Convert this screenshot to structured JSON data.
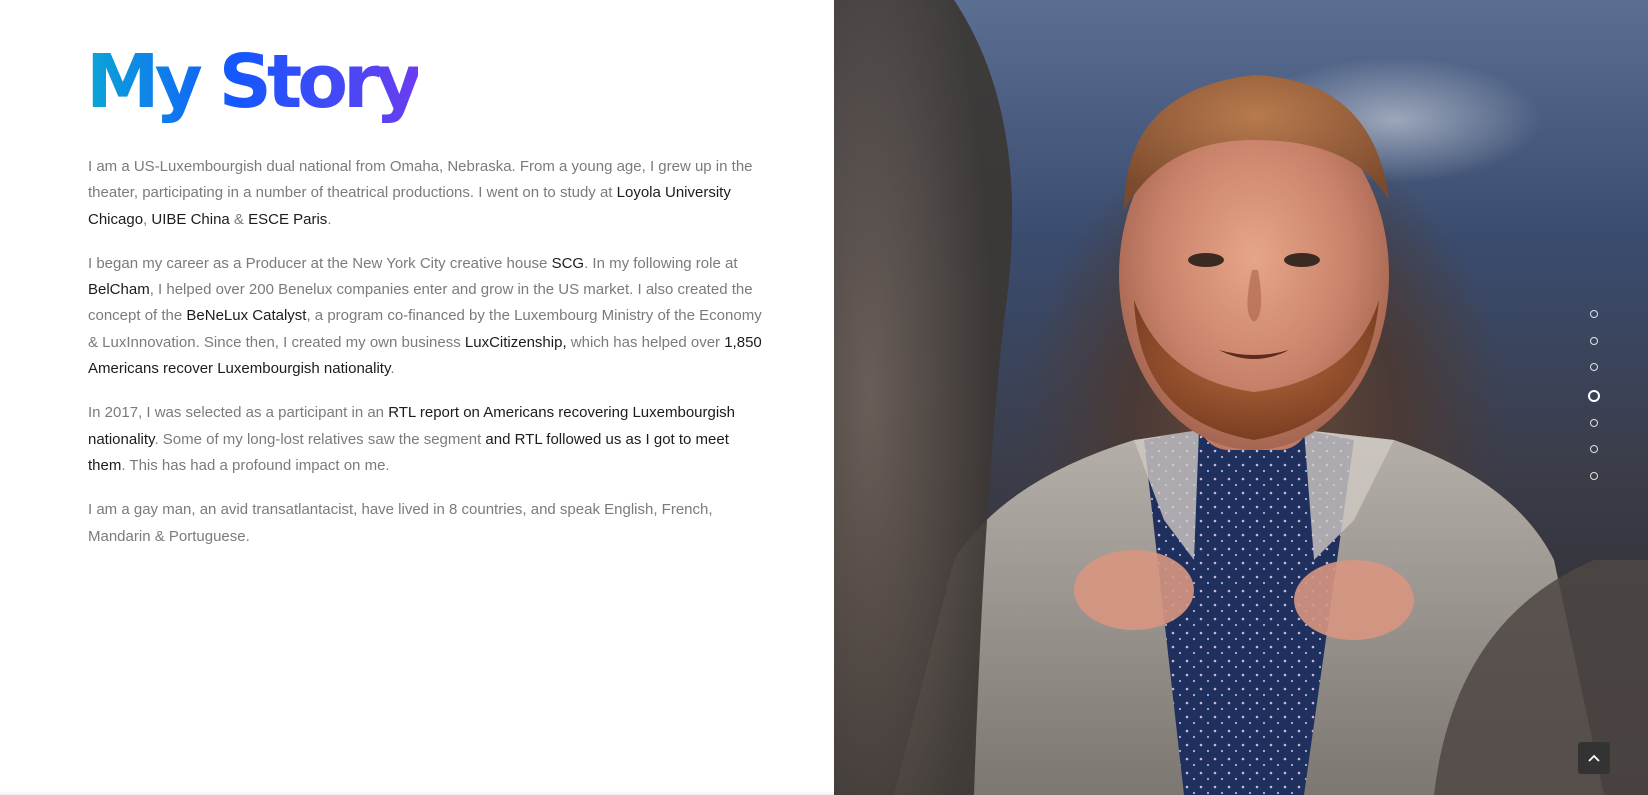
{
  "header": {
    "title": "My Story"
  },
  "story": {
    "p1": {
      "t1": "I am a US-Luxembourgish dual national from Omaha, Nebraska. From a young age, I grew up in the theater, participating in a number of theatrical productions. I went on to study at ",
      "link_loyola": "Loyola University Chicago",
      "t2": ", ",
      "link_uibe": "UIBE China",
      "t3": " & ",
      "link_esce": "ESCE Paris",
      "t4": "."
    },
    "p2": {
      "t1": "I began my career as a Producer at the New York City creative house ",
      "link_scg": "SCG",
      "t2": ". In my following role at ",
      "link_belcham": "BelCham",
      "t3": ", I helped over 200 Benelux companies enter and grow in the US market. I also created the concept of the ",
      "link_catalyst": "BeNeLux Catalyst",
      "t4": ", a program co-financed by the Luxembourg Ministry of the Economy & LuxInnovation. Since then, I created my own business ",
      "link_luxcitizenship": "LuxCitizenship,",
      "t5": " which has helped over ",
      "link_americans": "1,850 Americans recover Luxembourgish nationality",
      "t6": "."
    },
    "p3": {
      "t1": "In 2017, I was selected as a participant in an ",
      "link_rtl_report": "RTL report on Americans recovering Luxembourgish nationality",
      "t2": ". Some of my long-lost relatives saw the segment ",
      "link_rtl_followed": "and RTL followed us as I got to meet them",
      "t3": ". This has had a profound impact on me."
    },
    "p4": {
      "t1": "I am a gay man, an avid transatlantacist, have lived in 8 countries, and speak English, French, Mandarin & Portuguese."
    }
  },
  "section_nav": {
    "count": 7,
    "active_index": 3
  },
  "back_to_top": {
    "icon": "chevron-up-icon"
  },
  "colors": {
    "title_gradient": [
      "#0aa6d6",
      "#1457ff",
      "#6a3df0"
    ],
    "body_text": "#7b7b7b",
    "link_text": "#1c1c1c",
    "back_to_top_bg": "#333333"
  }
}
